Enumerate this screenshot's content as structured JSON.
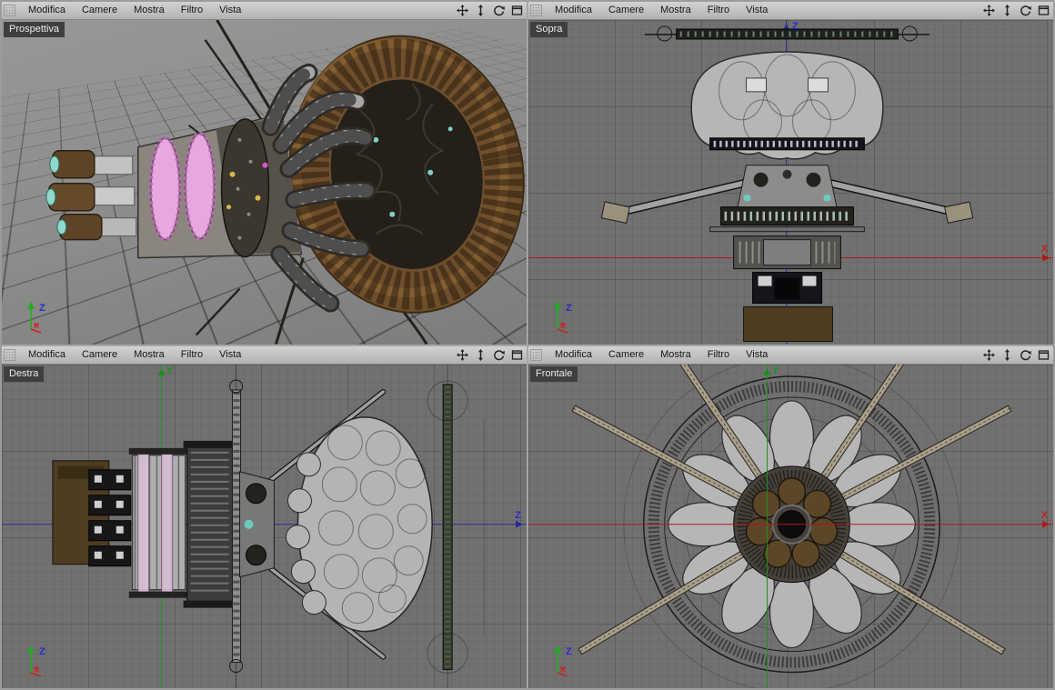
{
  "menus": {
    "items": [
      "Modifica",
      "Camere",
      "Mostra",
      "Filtro",
      "Vista"
    ]
  },
  "viewports": [
    {
      "label": "Prospettiva"
    },
    {
      "label": "Sopra",
      "v_axis_label": "Z",
      "h_axis_label": "X"
    },
    {
      "label": "Destra",
      "v_axis_label": "Y",
      "h_axis_label": "Z"
    },
    {
      "label": "Frontale",
      "v_axis_label": "Y",
      "h_axis_label": "X"
    }
  ],
  "gizmo": {
    "up_axis_label": "Z",
    "cross_axis_label": "x"
  },
  "icons": {
    "grip": "viewport-grip",
    "pan": "pan-view",
    "zoom": "zoom-view",
    "rotate": "rotate-view",
    "maximize": "toggle-maximize-view"
  },
  "colors": {
    "menubar_bg": "#bdbdbd",
    "ortho_bg": "#717171",
    "perspective_bg": "#8b8b8b",
    "viewport_label_bg": "#3f3f3f",
    "axis_x_red": "#b01818",
    "axis_y_green": "#1d8f1d",
    "axis_z_blue": "#2a2a9a",
    "model_brown": "#6e4e2b",
    "model_pink": "#e7a7df",
    "model_gray": "#b4b4b4"
  }
}
